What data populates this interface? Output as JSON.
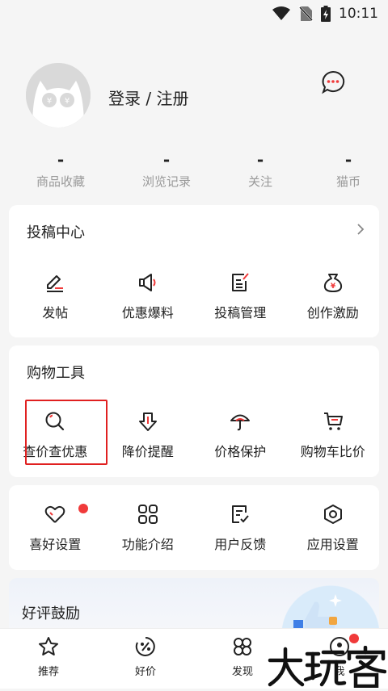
{
  "status": {
    "time": "10:11"
  },
  "profile": {
    "login_text": "登录 / 注册"
  },
  "stats": [
    {
      "value": "-",
      "label": "商品收藏"
    },
    {
      "value": "-",
      "label": "浏览记录"
    },
    {
      "value": "-",
      "label": "关注"
    },
    {
      "value": "-",
      "label": "猫币"
    }
  ],
  "submission": {
    "title": "投稿中心",
    "items": [
      {
        "label": "发帖",
        "icon": "edit-icon"
      },
      {
        "label": "优惠爆料",
        "icon": "megaphone-icon"
      },
      {
        "label": "投稿管理",
        "icon": "document-edit-icon"
      },
      {
        "label": "创作激励",
        "icon": "money-bag-icon"
      }
    ]
  },
  "shopping": {
    "title": "购物工具",
    "items": [
      {
        "label": "查价查优惠",
        "icon": "search-icon"
      },
      {
        "label": "降价提醒",
        "icon": "price-drop-icon"
      },
      {
        "label": "价格保护",
        "icon": "umbrella-icon"
      },
      {
        "label": "购物车比价",
        "icon": "cart-icon"
      }
    ]
  },
  "settings": {
    "items": [
      {
        "label": "喜好设置",
        "icon": "heart-icon"
      },
      {
        "label": "功能介绍",
        "icon": "grid-icon"
      },
      {
        "label": "用户反馈",
        "icon": "feedback-icon"
      },
      {
        "label": "应用设置",
        "icon": "settings-icon"
      }
    ]
  },
  "promo": {
    "title": "好评鼓励"
  },
  "tabbar": [
    {
      "label": "推荐",
      "icon": "star-icon"
    },
    {
      "label": "好价",
      "icon": "discount-icon"
    },
    {
      "label": "发现",
      "icon": "discover-icon"
    },
    {
      "label": "我",
      "icon": "user-icon"
    }
  ],
  "watermark": {
    "text": "大玩客"
  },
  "colors": {
    "accent": "#e02020",
    "text": "#222222",
    "muted": "#999999"
  }
}
